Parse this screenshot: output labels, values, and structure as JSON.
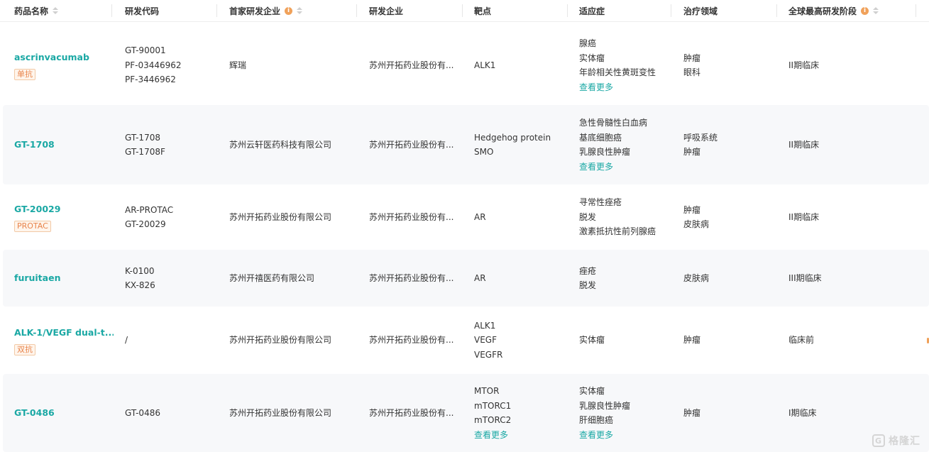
{
  "columns": [
    {
      "label": "药品名称"
    },
    {
      "label": "研发代码"
    },
    {
      "label": "首家研发企业"
    },
    {
      "label": "研发企业"
    },
    {
      "label": "靶点"
    },
    {
      "label": "适应症"
    },
    {
      "label": "治疗领域"
    },
    {
      "label": "全球最高研发阶段"
    }
  ],
  "rows": [
    {
      "name": "ascrinvacumab",
      "tag": "单抗",
      "codes": [
        "GT-90001",
        "PF-03446962",
        "PF-3446962"
      ],
      "first_company": "辉瑞",
      "company": "苏州开拓药业股份有...",
      "targets": [
        "ALK1"
      ],
      "targets_more": "",
      "indications": [
        "腺癌",
        "实体瘤",
        "年龄相关性黄斑变性"
      ],
      "indications_more": "查看更多",
      "areas": [
        "肿瘤",
        "眼科"
      ],
      "stage": "II期临床"
    },
    {
      "name": "GT-1708",
      "tag": "",
      "codes": [
        "GT-1708",
        "GT-1708F"
      ],
      "first_company": "苏州云轩医药科技有限公司",
      "company": "苏州开拓药业股份有...",
      "targets": [
        "Hedgehog protein",
        "SMO"
      ],
      "targets_more": "",
      "indications": [
        "急性骨髓性白血病",
        "基底细胞癌",
        "乳腺良性肿瘤"
      ],
      "indications_more": "查看更多",
      "areas": [
        "呼吸系统",
        "肿瘤"
      ],
      "stage": "II期临床"
    },
    {
      "name": "GT-20029",
      "tag": "PROTAC",
      "codes": [
        "AR-PROTAC",
        "GT-20029"
      ],
      "first_company": "苏州开拓药业股份有限公司",
      "company": "苏州开拓药业股份有...",
      "targets": [
        "AR"
      ],
      "targets_more": "",
      "indications": [
        "寻常性痤疮",
        "脱发",
        "激素抵抗性前列腺癌"
      ],
      "indications_more": "",
      "areas": [
        "肿瘤",
        "皮肤病"
      ],
      "stage": "II期临床"
    },
    {
      "name": "furuitaen",
      "tag": "",
      "codes": [
        "K-0100",
        "KX-826"
      ],
      "first_company": "苏州开禧医药有限公司",
      "company": "苏州开拓药业股份有...",
      "targets": [
        "AR"
      ],
      "targets_more": "",
      "indications": [
        "痤疮",
        "脱发"
      ],
      "indications_more": "",
      "areas": [
        "皮肤病"
      ],
      "stage": "III期临床"
    },
    {
      "name": "ALK-1/VEGF dual-t...",
      "tag": "双抗",
      "codes": [
        "/"
      ],
      "first_company": "苏州开拓药业股份有限公司",
      "company": "苏州开拓药业股份有...",
      "targets": [
        "ALK1",
        "VEGF",
        "VEGFR"
      ],
      "targets_more": "",
      "indications": [
        "实体瘤"
      ],
      "indications_more": "",
      "areas": [
        "肿瘤"
      ],
      "stage": "临床前"
    },
    {
      "name": "GT-0486",
      "tag": "",
      "codes": [
        "GT-0486"
      ],
      "first_company": "苏州开拓药业股份有限公司",
      "company": "苏州开拓药业股份有...",
      "targets": [
        "MTOR",
        "mTORC1",
        "mTORC2"
      ],
      "targets_more": "查看更多",
      "indications": [
        "实体瘤",
        "乳腺良性肿瘤",
        "肝细胞癌"
      ],
      "indications_more": "查看更多",
      "areas": [
        "肿瘤"
      ],
      "stage": "I期临床"
    }
  ],
  "watermark": {
    "logo": "G",
    "text": "格隆汇"
  },
  "colors": {
    "accent": "#1aa8a4",
    "tag": "#e8834a",
    "row_alt": "#f7f8fa"
  }
}
